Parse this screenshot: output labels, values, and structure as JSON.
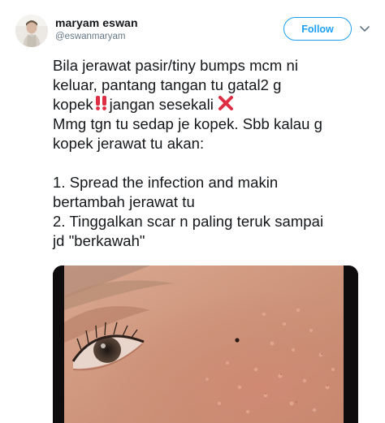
{
  "user": {
    "display_name": "maryam eswan",
    "handle": "@eswanmaryam",
    "avatar_icon": "avatar-photo"
  },
  "actions": {
    "follow_label": "Follow",
    "menu_icon": "chevron-down-icon"
  },
  "tweet": {
    "lines": [
      "Bila jerawat pasir/tiny bumps mcm ni",
      "keluar, pantang tangan tu gatal2 g",
      "kopek",
      "jangan sesekali",
      "Mmg tgn tu sedap je kopek. Sbb kalau g",
      "kopek jerawat tu akan:",
      "",
      "1. Spread the infection and makin",
      "bertambah jerawat tu",
      "2. Tinggalkan scar n paling teruk sampai",
      "jd \"berkawah\""
    ],
    "emoji_1": "double-exclamation-icon",
    "emoji_2": "cross-mark-icon"
  },
  "media": {
    "type": "photo",
    "subject": "close-up-face-with-bumps"
  },
  "colors": {
    "accent": "#1da1f2",
    "text": "#14171a",
    "secondary": "#657786",
    "emoji_red": "#dd2e44"
  }
}
